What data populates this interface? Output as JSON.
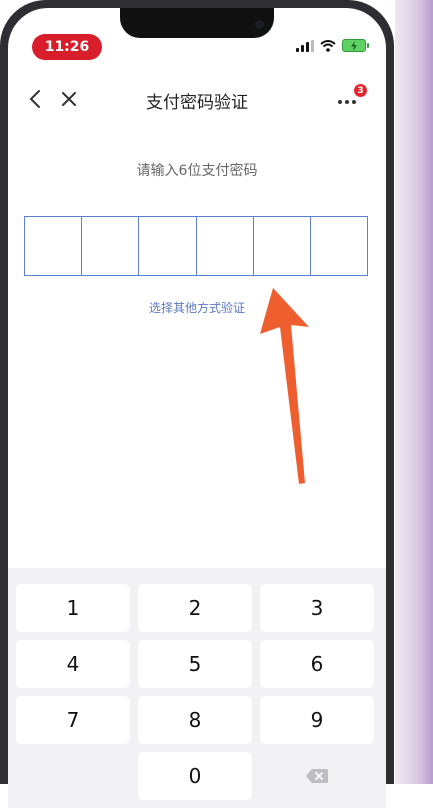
{
  "status_bar": {
    "time": "11:26"
  },
  "header": {
    "title": "支付密码验证",
    "badge_count": "3",
    "icons": {
      "back": "chevron-left-icon",
      "close": "close-icon",
      "more": "more-dots-icon"
    }
  },
  "main": {
    "prompt": "请输入6位支付密码",
    "password_length": 6,
    "other_method_link": "选择其他方式验证"
  },
  "keypad": {
    "row1": [
      "1",
      "2",
      "3"
    ],
    "row2": [
      "4",
      "5",
      "6"
    ],
    "row3": [
      "7",
      "8",
      "9"
    ],
    "zero": "0",
    "delete_icon": "backspace-icon"
  },
  "colors": {
    "accent_blue": "#5b7fd1",
    "time_pill": "#d81e2a",
    "arrow": "#ee5e2e",
    "keypad_bg": "#f1f1f3"
  }
}
